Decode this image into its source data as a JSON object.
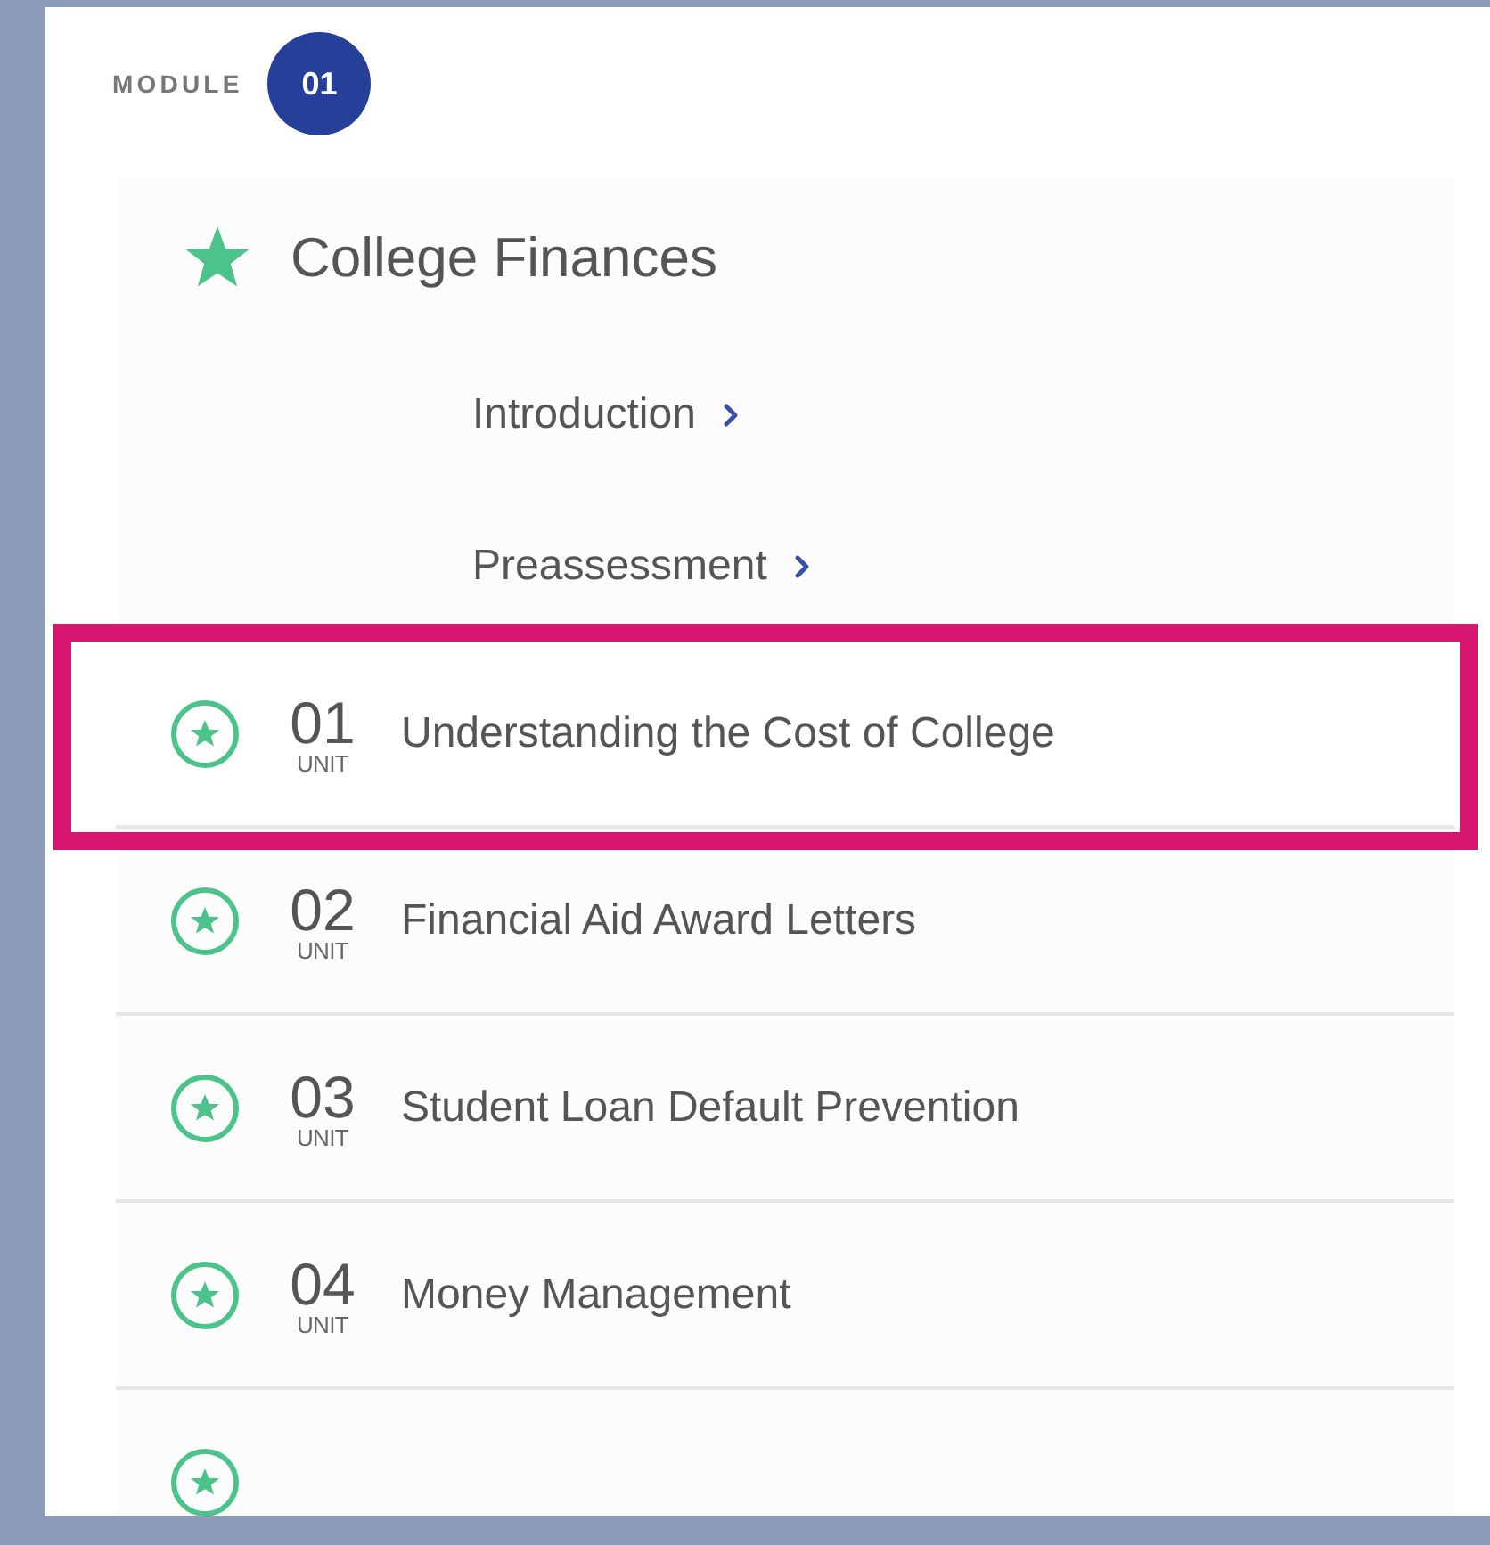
{
  "module": {
    "label": "MODULE",
    "number": "01"
  },
  "course": {
    "title": "College Finances"
  },
  "links": [
    {
      "label": "Introduction"
    },
    {
      "label": "Preassessment"
    }
  ],
  "units": [
    {
      "number": "01",
      "unit_label": "UNIT",
      "title": "Understanding the Cost of College",
      "selected": true
    },
    {
      "number": "02",
      "unit_label": "UNIT",
      "title": "Financial Aid Award Letters",
      "selected": false
    },
    {
      "number": "03",
      "unit_label": "UNIT",
      "title": "Student Loan Default Prevention",
      "selected": false
    },
    {
      "number": "04",
      "unit_label": "UNIT",
      "title": "Money Management",
      "selected": false
    }
  ]
}
